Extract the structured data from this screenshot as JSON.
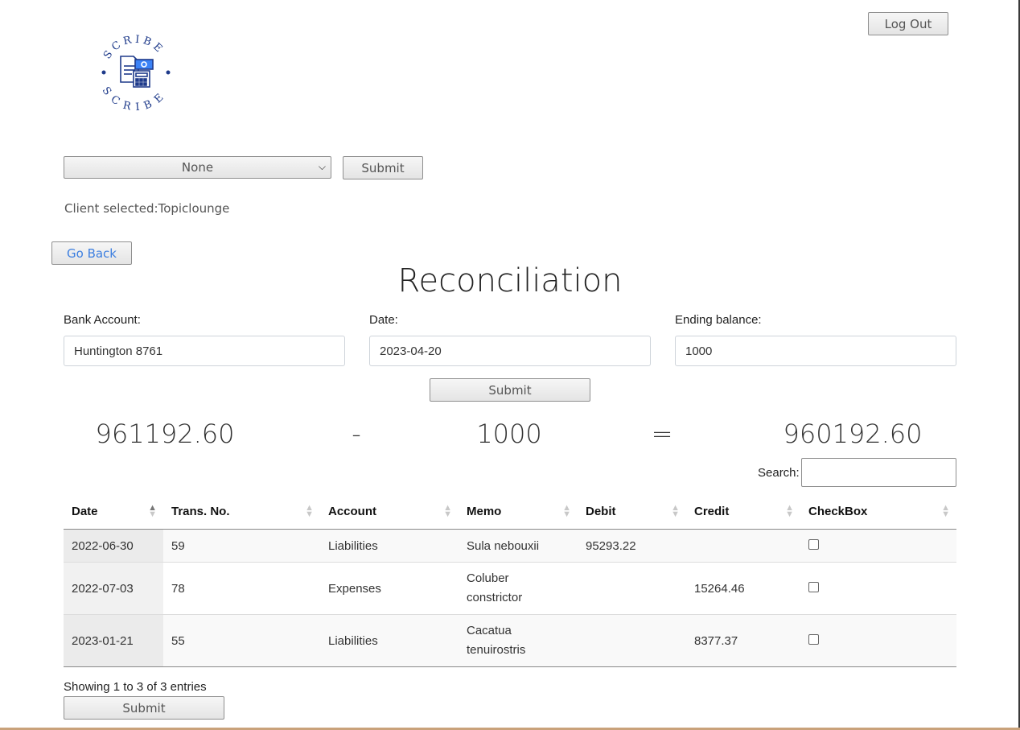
{
  "header": {
    "logout_label": "Log Out",
    "logo_text": "SCRIBE"
  },
  "client_select": {
    "selected": "None",
    "submit_label": "Submit",
    "client_selected_label": "Client selected:",
    "client_name": "Topiclounge"
  },
  "nav": {
    "go_back_label": "Go Back"
  },
  "page": {
    "title": "Reconciliation"
  },
  "form": {
    "bank_label": "Bank Account:",
    "bank_value": "Huntington 8761",
    "date_label": "Date:",
    "date_value": "2023-04-20",
    "balance_label": "Ending balance:",
    "balance_value": "1000",
    "submit_label": "Submit"
  },
  "equation": {
    "left": "961192.60",
    "minus": "-",
    "middle": "1000",
    "equals": "=",
    "result": "960192.60"
  },
  "search": {
    "label": "Search:"
  },
  "table": {
    "columns": [
      "Date",
      "Trans. No.",
      "Account",
      "Memo",
      "Debit",
      "Credit",
      "CheckBox"
    ],
    "rows": [
      {
        "date": "2022-06-30",
        "trans": "59",
        "account": "Liabilities",
        "memo1": "Sula nebouxii",
        "memo2": "",
        "debit": "95293.22",
        "credit": ""
      },
      {
        "date": "2022-07-03",
        "trans": "78",
        "account": "Expenses",
        "memo1": "Coluber",
        "memo2": "constrictor",
        "debit": "",
        "credit": "15264.46"
      },
      {
        "date": "2023-01-21",
        "trans": "55",
        "account": "Liabilities",
        "memo1": "Cacatua",
        "memo2": "tenuirostris",
        "debit": "",
        "credit": "8377.37"
      }
    ],
    "info": "Showing 1 to 3 of 3 entries"
  },
  "footer": {
    "submit_label": "Submit"
  },
  "colors": {
    "logo": "#1e3a8a",
    "link": "#3d7fe0"
  }
}
